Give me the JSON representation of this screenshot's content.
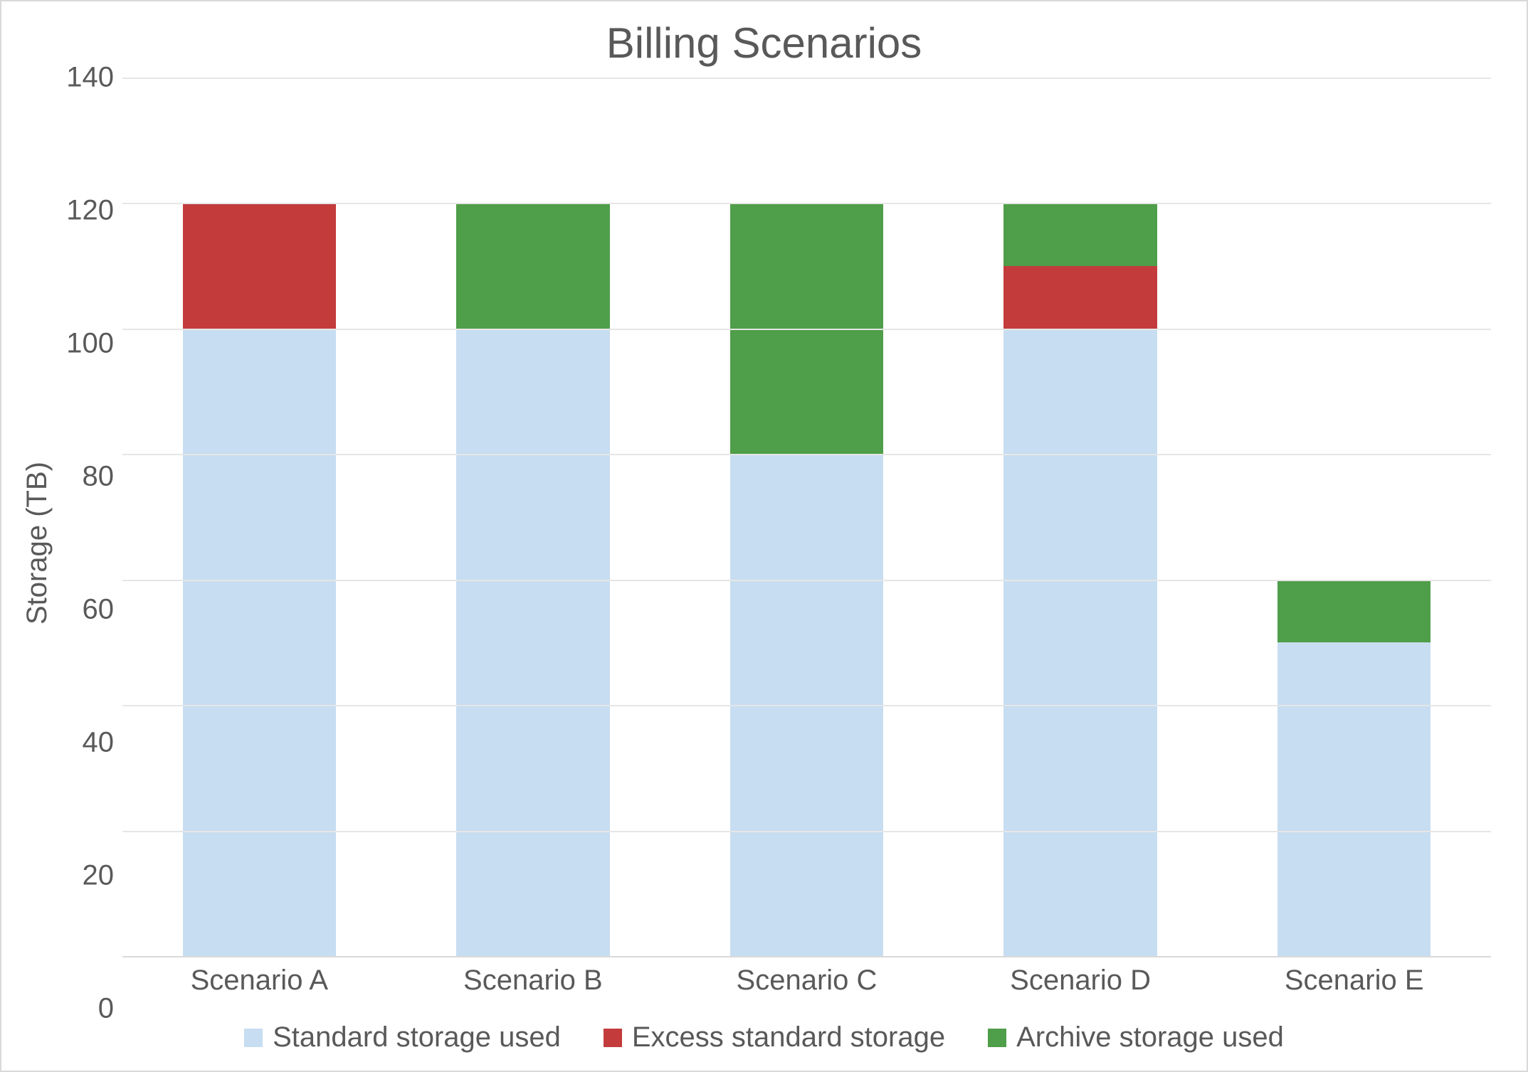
{
  "chart_data": {
    "type": "bar",
    "title": "Billing Scenarios",
    "ylabel": "Storage (TB)",
    "xlabel": "",
    "ylim": [
      0,
      140
    ],
    "ytick_step": 20,
    "categories": [
      "Scenario A",
      "Scenario B",
      "Scenario C",
      "Scenario D",
      "Scenario E"
    ],
    "series": [
      {
        "name": "Standard storage used",
        "color": "#c7ddf1",
        "values": [
          100,
          100,
          80,
          100,
          50
        ]
      },
      {
        "name": "Excess standard storage",
        "color": "#c43b3c",
        "values": [
          20,
          0,
          0,
          10,
          0
        ]
      },
      {
        "name": "Archive storage used",
        "color": "#4f9e49",
        "values": [
          0,
          20,
          40,
          10,
          10
        ]
      }
    ],
    "legend_position": "bottom",
    "grid": true
  }
}
